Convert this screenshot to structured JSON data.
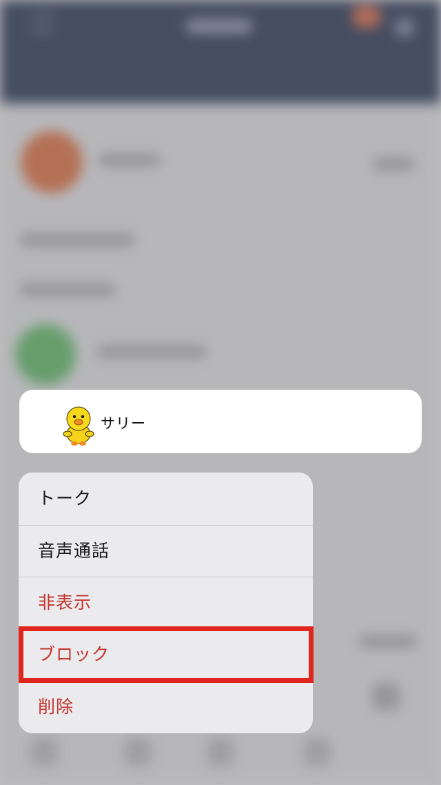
{
  "preview": {
    "contact_name": "サリー",
    "avatar_icon": "sally-chick-icon"
  },
  "menu": {
    "items": [
      {
        "label": "トーク",
        "style": "normal"
      },
      {
        "label": "音声通話",
        "style": "normal"
      },
      {
        "label": "非表示",
        "style": "destructive"
      },
      {
        "label": "ブロック",
        "style": "destructive",
        "highlighted": true
      },
      {
        "label": "削除",
        "style": "destructive"
      }
    ]
  },
  "colors": {
    "destructive": "#c4332d",
    "highlight_border": "#e1261f",
    "header_background": "#1f2a45",
    "menu_background": "#ebebed"
  }
}
